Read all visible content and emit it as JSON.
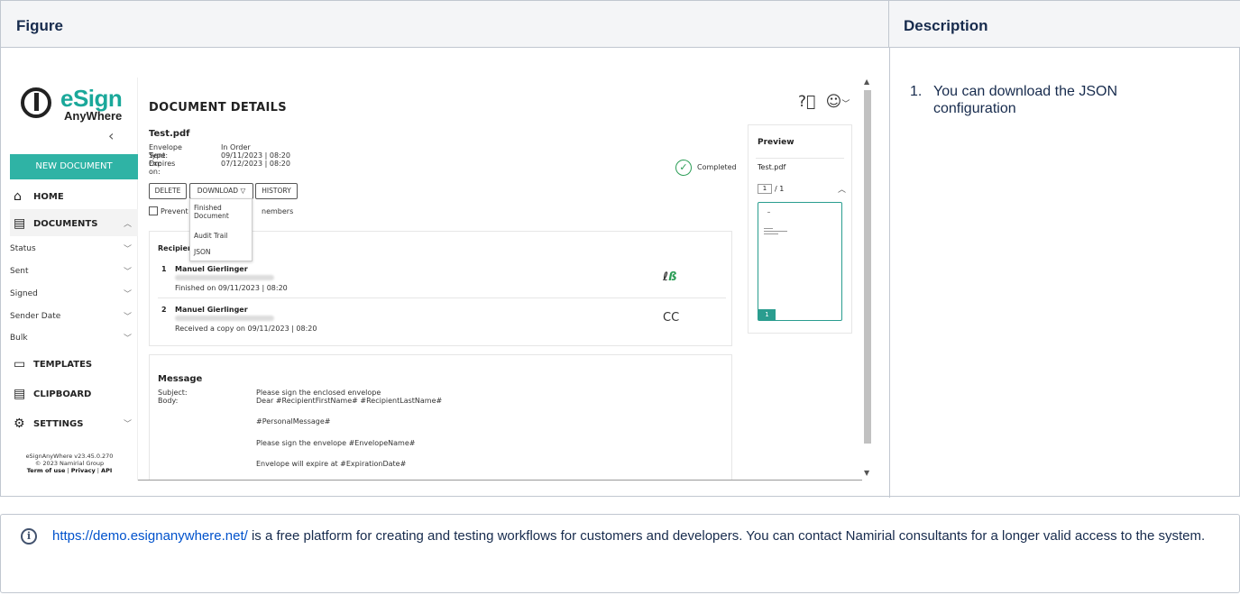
{
  "table": {
    "header_figure": "Figure",
    "header_description": "Description"
  },
  "description": {
    "number": "1.",
    "text": "You can download the JSON configuration"
  },
  "app": {
    "logo_e": "eSign",
    "logo_sub": "AnyWhere",
    "collapse_icon": "‹",
    "new_document": "NEW DOCUMENT",
    "nav": {
      "home": "HOME",
      "documents": "DOCUMENTS",
      "templates": "TEMPLATES",
      "clipboard": "CLIPBOARD",
      "settings": "SETTINGS"
    },
    "doc_subitems": [
      "Status",
      "Sent",
      "Signed",
      "Sender Date",
      "Bulk"
    ],
    "footer": {
      "version": "eSignAnyWhere v23.45.0.270",
      "copyright": "© 2023 Namirial Group",
      "terms": "Term of use",
      "privacy": "Privacy",
      "api": "API",
      "sep": "|"
    },
    "page_title": "DOCUMENT DETAILS",
    "file_name": "Test.pdf",
    "meta": [
      {
        "key": "Envelope Type:",
        "value": "In Order"
      },
      {
        "key": "Sent On:",
        "value": "09/11/2023 | 08:20"
      },
      {
        "key": "Expires on:",
        "value": "07/12/2023 | 08:20"
      }
    ],
    "buttons": {
      "delete": "DELETE",
      "download": "DOWNLOAD ▽",
      "history": "HISTORY"
    },
    "checkbox_label_a": "Prevent s",
    "checkbox_label_b": "nembers",
    "dropdown": [
      "Finished Document",
      "Audit Trail",
      "JSON"
    ],
    "status": "Completed",
    "recipients_header": "Recipient",
    "recipients": [
      {
        "num": "1",
        "name": "Manuel Gierlinger",
        "status": "Finished on 09/11/2023 | 08:20",
        "icon": "sign-icon"
      },
      {
        "num": "2",
        "name": "Manuel Gierlinger",
        "status": "Received a copy on 09/11/2023 | 08:20",
        "icon": "cc"
      }
    ],
    "cc_label": "CC",
    "message": {
      "header": "Message",
      "subject_label": "Subject:",
      "body_label": "Body:",
      "subject": "Please sign the enclosed envelope",
      "body_lines": [
        "Dear #RecipientFirstName# #RecipientLastName#",
        "#PersonalMessage#",
        "Please sign the envelope #EnvelopeName#",
        "Envelope will expire at #ExpirationDate#"
      ]
    },
    "preview": {
      "title": "Preview",
      "file": "Test.pdf",
      "page_current": "1",
      "page_total": "/ 1",
      "thumb_page": "1"
    }
  },
  "info": {
    "link": "https://demo.esignanywhere.net/",
    "text": " is a free platform for creating and testing workflows for customers and developers. You can contact Namirial consultants for a longer valid access to the system."
  },
  "colors": {
    "accent": "#2fb3a5",
    "link": "#0052cc",
    "completed": "#2a9d55"
  }
}
